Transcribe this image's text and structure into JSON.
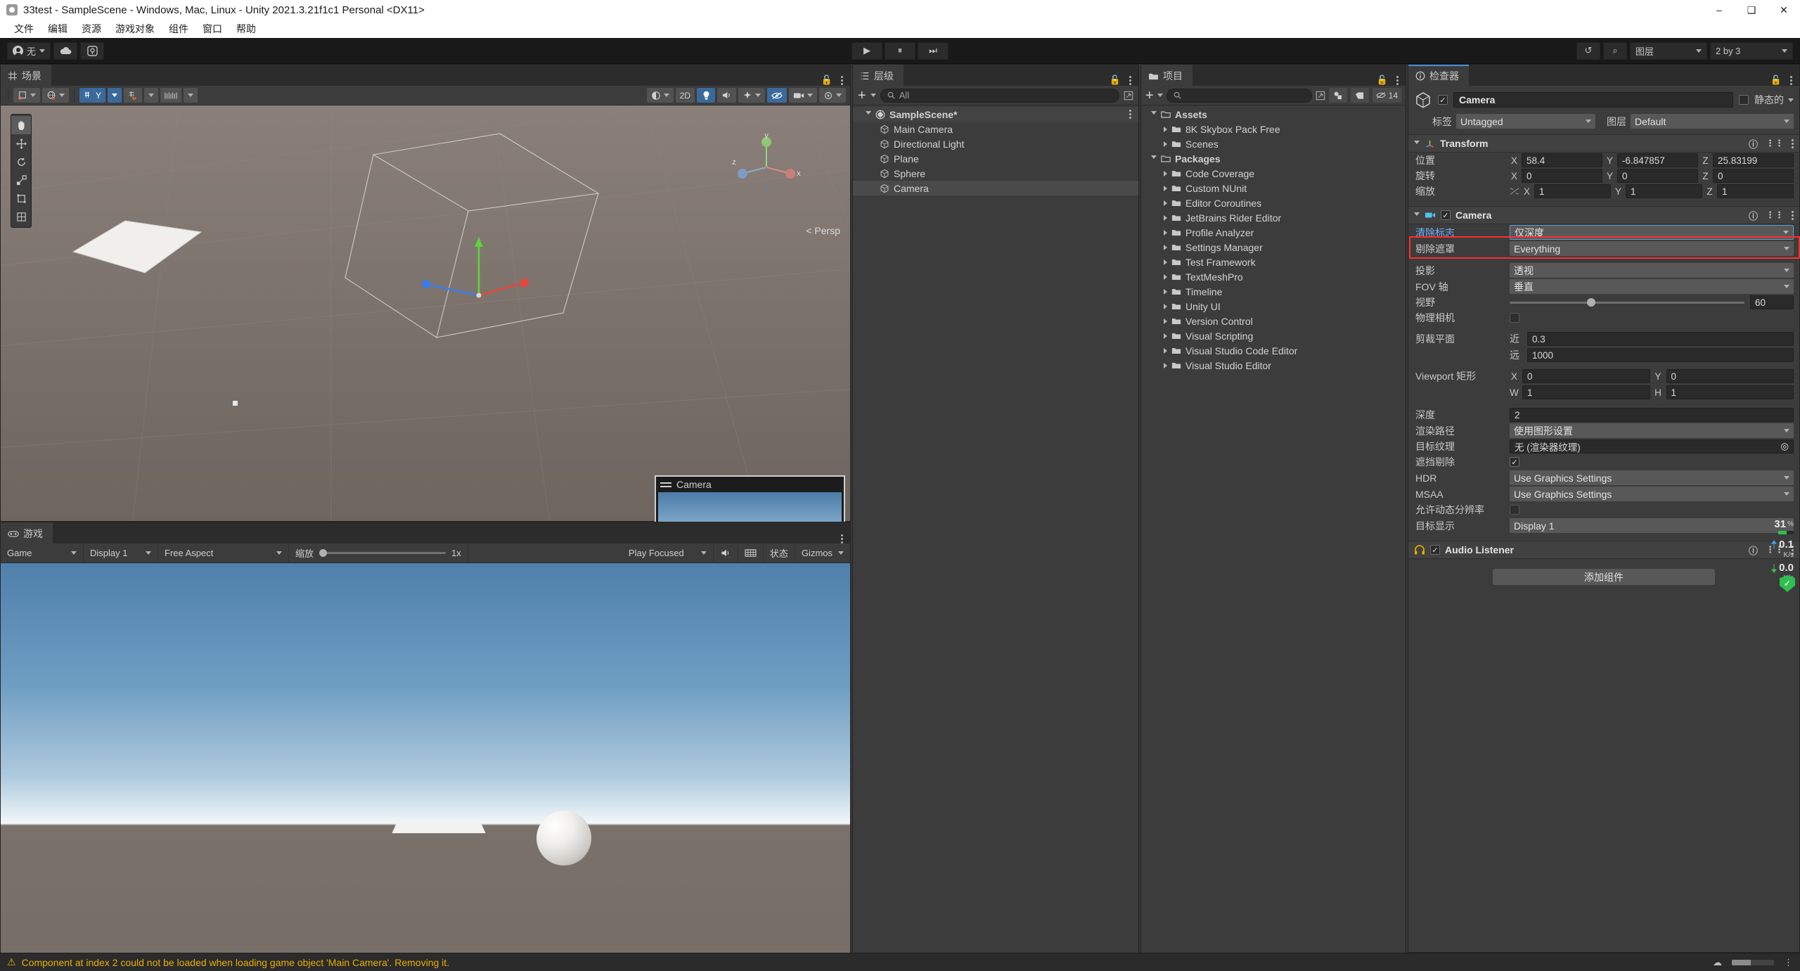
{
  "window": {
    "title": "33test - SampleScene - Windows, Mac, Linux - Unity 2021.3.21f1c1 Personal <DX11>",
    "minimize": "–",
    "maximize": "❑",
    "close": "✕"
  },
  "menubar": {
    "items": [
      "文件",
      "编辑",
      "资源",
      "游戏对象",
      "组件",
      "窗口",
      "帮助"
    ]
  },
  "toolbar": {
    "account_label": "无",
    "cloud_label": "",
    "services_label": "",
    "play": "▶",
    "pause": "⏸",
    "step": "⏭",
    "undo_history": "↺",
    "search": "⌕",
    "layers_label": "图层",
    "layout_label": "2 by 3"
  },
  "scene": {
    "tab_label": "场景",
    "tools": [
      {
        "name": "hand-tool",
        "glyph": "✋",
        "selected": true
      },
      {
        "name": "move-tool",
        "glyph": "✥",
        "selected": false
      },
      {
        "name": "rotate-tool",
        "glyph": "↻",
        "selected": false
      },
      {
        "name": "scale-tool",
        "glyph": "⬌",
        "selected": false
      },
      {
        "name": "rect-tool",
        "glyph": "▣",
        "selected": false
      },
      {
        "name": "transform-tool",
        "glyph": "✲",
        "selected": false
      }
    ],
    "toolbar_buttons": [
      {
        "name": "shading-mode",
        "label": "",
        "glyph": "◐",
        "type": "dropdown"
      },
      {
        "name": "2d-toggle",
        "label": "2D",
        "glyph": "",
        "type": "button"
      },
      {
        "name": "lighting-toggle",
        "label": "",
        "glyph": "Ὂ1",
        "type": "button"
      },
      {
        "name": "audio-toggle",
        "label": "",
        "glyph": "ὐ8",
        "type": "button"
      },
      {
        "name": "fx-toggle",
        "label": "",
        "glyph": "✨",
        "type": "dropdown"
      },
      {
        "name": "hidden-objects",
        "label": "",
        "glyph": "ὄ1",
        "type": "button"
      },
      {
        "name": "camera-settings",
        "label": "",
        "glyph": "὏7",
        "type": "dropdown"
      },
      {
        "name": "gizmos-toggle",
        "label": "",
        "glyph": "⚪",
        "type": "dropdown"
      }
    ],
    "left_buttons": [
      {
        "name": "pivot-toggle",
        "glyph": "⧉"
      },
      {
        "name": "global-toggle",
        "glyph": "ἱ0"
      },
      {
        "name": "grid-snap-toggle",
        "glyph": "⌗",
        "label": "Y",
        "active": true
      },
      {
        "name": "magnet-snap-toggle",
        "glyph": "ᾟ2"
      },
      {
        "name": "increment-snap",
        "glyph": "⚌"
      }
    ],
    "persp_label": "< Persp",
    "gizmo_axes": {
      "x": "x",
      "y": "y",
      "z": "z"
    },
    "camera_preview_title": "Camera"
  },
  "game": {
    "tab_label": "游戏",
    "mode": "Game",
    "display": "Display 1",
    "aspect": "Free Aspect",
    "scale_label": "缩放",
    "scale_value": "1x",
    "play_mode": "Play Focused",
    "mute_label": "",
    "stats_label": "状态",
    "gizmos_label": "Gizmos"
  },
  "hierarchy": {
    "tab_label": "层级",
    "search_placeholder": "All",
    "create_label": "+",
    "items": [
      {
        "label": "SampleScene*",
        "depth": 0,
        "icon": "unity-scene-icon",
        "expanded": true,
        "selected": false,
        "bold": true
      },
      {
        "label": "Main Camera",
        "depth": 1,
        "icon": "gameobject-icon",
        "selected": false
      },
      {
        "label": "Directional Light",
        "depth": 1,
        "icon": "gameobject-icon",
        "selected": false
      },
      {
        "label": "Plane",
        "depth": 1,
        "icon": "gameobject-icon",
        "selected": false
      },
      {
        "label": "Sphere",
        "depth": 1,
        "icon": "gameobject-icon",
        "selected": false
      },
      {
        "label": "Camera",
        "depth": 1,
        "icon": "gameobject-icon",
        "selected": true
      }
    ]
  },
  "project": {
    "tab_label": "项目",
    "search_placeholder": "",
    "hidden_count": "14",
    "items": [
      {
        "label": "Assets",
        "depth": 0,
        "expanded": true,
        "bold": true
      },
      {
        "label": "8K Skybox Pack Free",
        "depth": 1,
        "expanded": false
      },
      {
        "label": "Scenes",
        "depth": 1,
        "expanded": false
      },
      {
        "label": "Packages",
        "depth": 0,
        "expanded": true,
        "bold": true
      },
      {
        "label": "Code Coverage",
        "depth": 1,
        "expanded": false
      },
      {
        "label": "Custom NUnit",
        "depth": 1,
        "expanded": false
      },
      {
        "label": "Editor Coroutines",
        "depth": 1,
        "expanded": false
      },
      {
        "label": "JetBrains Rider Editor",
        "depth": 1,
        "expanded": false
      },
      {
        "label": "Profile Analyzer",
        "depth": 1,
        "expanded": false
      },
      {
        "label": "Settings Manager",
        "depth": 1,
        "expanded": false
      },
      {
        "label": "Test Framework",
        "depth": 1,
        "expanded": false
      },
      {
        "label": "TextMeshPro",
        "depth": 1,
        "expanded": false
      },
      {
        "label": "Timeline",
        "depth": 1,
        "expanded": false
      },
      {
        "label": "Unity UI",
        "depth": 1,
        "expanded": false
      },
      {
        "label": "Version Control",
        "depth": 1,
        "expanded": false
      },
      {
        "label": "Visual Scripting",
        "depth": 1,
        "expanded": false
      },
      {
        "label": "Visual Studio Code Editor",
        "depth": 1,
        "expanded": false
      },
      {
        "label": "Visual Studio Editor",
        "depth": 1,
        "expanded": false
      }
    ]
  },
  "inspector": {
    "tab_label": "检查器",
    "object_name": "Camera",
    "static_label": "静态的",
    "tag_label": "标签",
    "tag_value": "Untagged",
    "layer_label": "图层",
    "layer_value": "Default",
    "transform": {
      "title": "Transform",
      "position_label": "位置",
      "rotation_label": "旋转",
      "scale_label": "缩放",
      "axes": [
        "X",
        "Y",
        "Z"
      ],
      "position": [
        "58.4",
        "-6.847857",
        "25.83199"
      ],
      "rotation": [
        "0",
        "0",
        "0"
      ],
      "scale": [
        "1",
        "1",
        "1"
      ]
    },
    "camera": {
      "title": "Camera",
      "clear_flags_label": "清除标志",
      "clear_flags_value": "仅深度",
      "culling_mask_label": "剔除遮罩",
      "culling_mask_value": "Everything",
      "projection_label": "投影",
      "projection_value": "透视",
      "fov_axis_label": "FOV 轴",
      "fov_axis_value": "垂直",
      "field_of_view_label": "视野",
      "field_of_view_value": "60",
      "physical_camera_label": "物理相机",
      "clipping_planes_label": "剪裁平面",
      "near_label": "近",
      "near_value": "0.3",
      "far_label": "远",
      "far_value": "1000",
      "viewport_rect_label": "Viewport 矩形",
      "viewport_x_label": "X",
      "viewport_x": "0",
      "viewport_y_label": "Y",
      "viewport_y": "0",
      "viewport_w_label": "W",
      "viewport_w": "1",
      "viewport_h_label": "H",
      "viewport_h": "1",
      "depth_label": "深度",
      "depth_value": "2",
      "rendering_path_label": "渲染路径",
      "rendering_path_value": "使用图形设置",
      "target_texture_label": "目标纹理",
      "target_texture_value": "无 (渲染器纹理)",
      "occlusion_culling_label": "遮挡剔除",
      "hdr_label": "HDR",
      "hdr_value": "Use Graphics Settings",
      "msaa_label": "MSAA",
      "msaa_value": "Use Graphics Settings",
      "dynamic_resolution_label": "允许动态分辨率",
      "target_display_label": "目标显示",
      "target_display_value": "Display 1"
    },
    "audio_listener": {
      "title": "Audio Listener"
    },
    "add_component_label": "添加组件"
  },
  "overlay_perf": {
    "cpu_percent": "31",
    "percent_unit": "%",
    "upload_rate": "0.1",
    "upload_unit": "K/s",
    "download_rate": "0.0",
    "download_unit": "K/s"
  },
  "statusbar": {
    "warning_icon": "⚠",
    "message": "Component at index 2 could not be loaded when loading game object 'Main Camera'. Removing it."
  },
  "colors": {
    "accent_blue": "#4a90d9",
    "highlight_red": "#ff2d2d",
    "warning_yellow": "#e8b000",
    "panel_bg": "#3c3c3c",
    "toolbar_bg": "#191919"
  }
}
